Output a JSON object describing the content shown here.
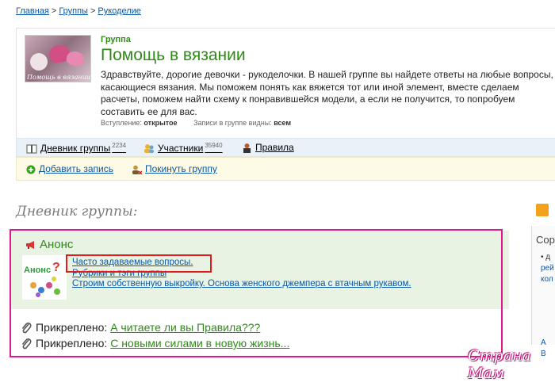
{
  "breadcrumb": {
    "home": "Главная",
    "groups": "Группы",
    "crafts": "Рукоделие",
    "sep": ">"
  },
  "group": {
    "image_caption": "Помощь в вязании",
    "kind": "Группа",
    "title": "Помощь в вязании",
    "description": "Здравствуйте, дорогие девочки - рукоделочки. В нашей группе вы найдете ответы на любые вопросы, касающиеся вязания. Мы поможем понять как вяжется тот или иной элемент, вместе сделаем расчеты, поможем найти схему к понравившейся модели, а если не получится, то попробуем составить ее для вас.",
    "meta": {
      "join_label": "Вступление:",
      "join_value": "открытое",
      "visibility_label": "Записи в группе видны:",
      "visibility_value": "всем"
    }
  },
  "tabs": [
    {
      "label": "Дневник группы",
      "count": "2234",
      "icon": "book-icon"
    },
    {
      "label": "Участники",
      "count": "35940",
      "icon": "people-icon"
    },
    {
      "label": "Правила",
      "count": "",
      "icon": "rules-icon"
    }
  ],
  "actions": {
    "add_post": "Добавить запись",
    "leave_group": "Покинуть группу"
  },
  "diary": {
    "section_title": "Дневник группы:",
    "anons": {
      "title": "Анонс",
      "image_caption": "Анонс",
      "links": [
        "Часто задаваемые вопросы.",
        "Рубрики и тэги группы",
        "Строим собственную выкройку. Основа женского джемпера с втачным рукавом."
      ]
    },
    "pinned_label": "Прикреплено:",
    "pinned": [
      "А читаете ли вы Правила???",
      "С новыми силами в новую жизнь..."
    ]
  },
  "right_sidebar": {
    "word": "Сор",
    "bullet": "• д",
    "lines": [
      "рей",
      "кол"
    ],
    "links": [
      "А",
      "В"
    ]
  },
  "watermark": "Страна Мам",
  "colors": {
    "accent_green": "#2f8a18",
    "link_blue": "#0b58a8",
    "highlight_magenta": "#e0198a",
    "highlight_red": "#e01d1d"
  }
}
